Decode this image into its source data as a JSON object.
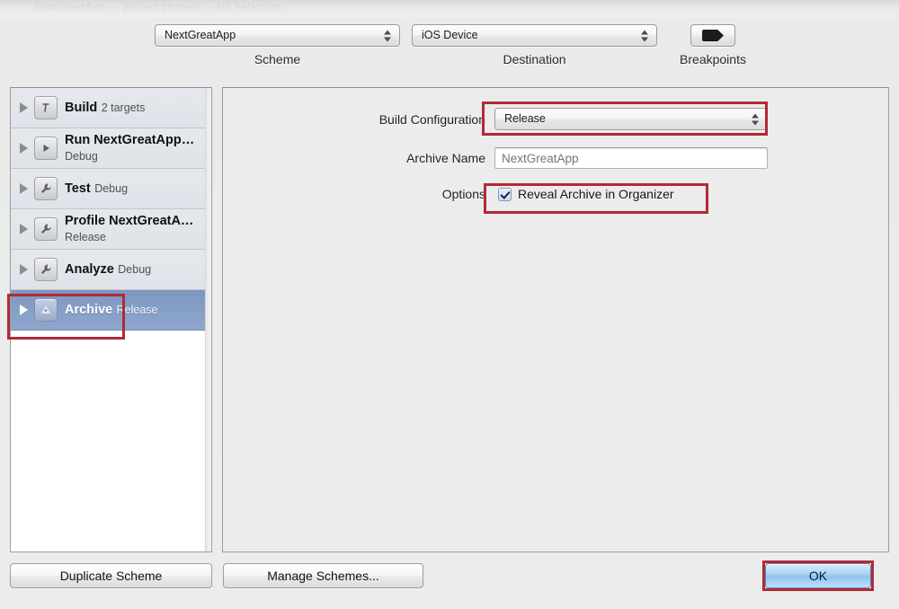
{
  "window": {
    "title": "NextGreatApp — project.pbxproj — No Selection"
  },
  "toolbar": {
    "scheme": {
      "value": "NextGreatApp",
      "label": "Scheme",
      "icon": "updown-arrows-icon"
    },
    "destination": {
      "value": "iOS Device",
      "label": "Destination",
      "icon": "updown-arrows-icon"
    },
    "breakpoints": {
      "label": "Breakpoints",
      "icon": "breakpoint-arrow-icon"
    }
  },
  "scheme_list": {
    "items": [
      {
        "title": "Build",
        "subtitle": "2 targets",
        "icon": "hammer-icon",
        "selected": false
      },
      {
        "title": "Run NextGreatApp…",
        "subtitle": "Debug",
        "icon": "run-play-icon",
        "selected": false
      },
      {
        "title": "Test",
        "subtitle": "Debug",
        "icon": "wrench-icon",
        "selected": false
      },
      {
        "title": "Profile NextGreatA…",
        "subtitle": "Release",
        "icon": "wrench-icon",
        "selected": false
      },
      {
        "title": "Analyze",
        "subtitle": "Debug",
        "icon": "wrench-icon",
        "selected": false
      },
      {
        "title": "Archive",
        "subtitle": "Release",
        "icon": "archive-icon",
        "selected": true
      }
    ]
  },
  "detail": {
    "build_configuration": {
      "label": "Build Configuration",
      "value": "Release"
    },
    "archive_name": {
      "label": "Archive Name",
      "placeholder": "NextGreatApp",
      "value": ""
    },
    "options": {
      "label": "Options",
      "reveal_archive": {
        "label": "Reveal Archive in Organizer",
        "checked": true
      }
    }
  },
  "footer": {
    "duplicate_scheme": "Duplicate Scheme",
    "manage_schemes": "Manage Schemes...",
    "ok": "OK"
  },
  "colors": {
    "annotation_red": "#b12a36",
    "selection_blue": "#7d97c1",
    "default_button_blue": "#8cc2f0",
    "pane_background": "#ececec"
  }
}
